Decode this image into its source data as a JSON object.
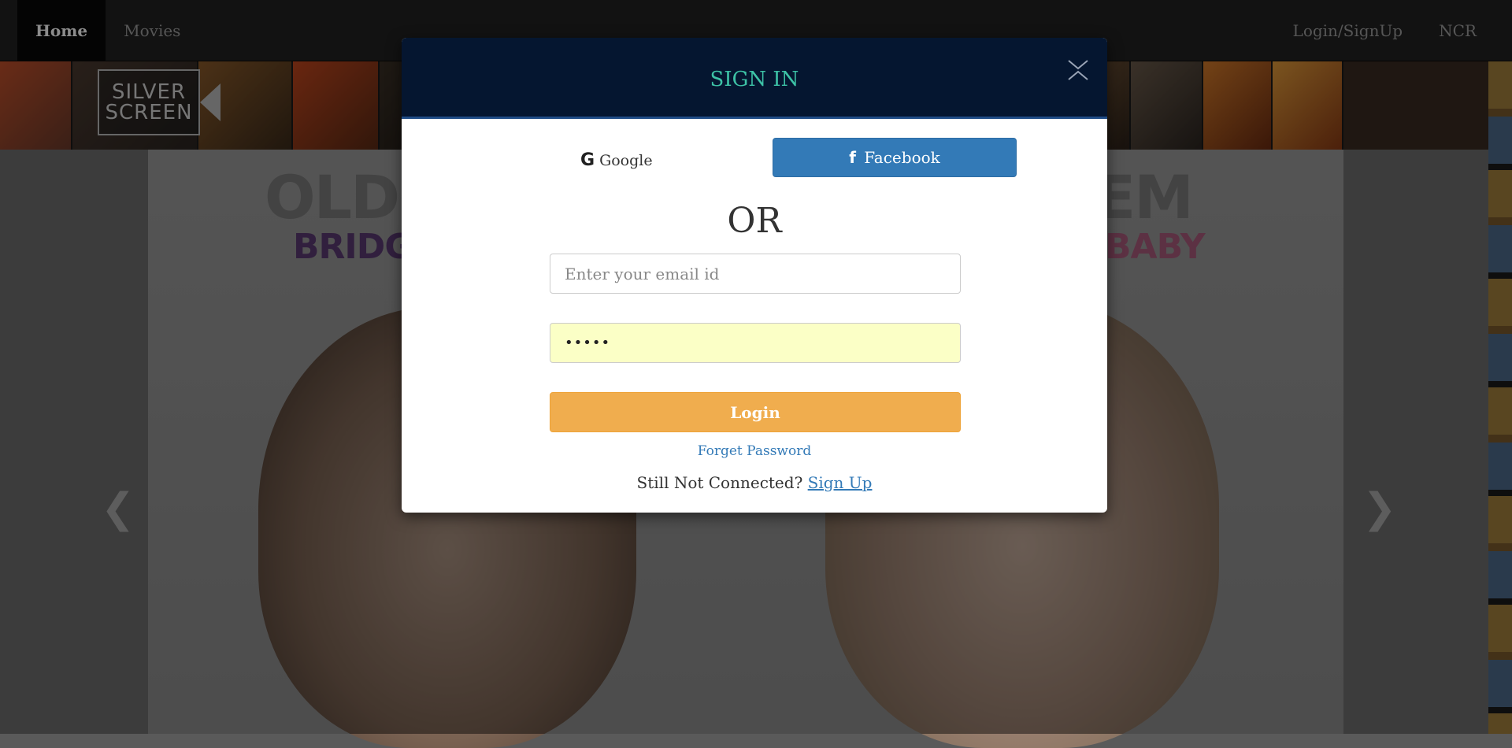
{
  "navbar": {
    "home_label": "Home",
    "movies_label": "Movies",
    "login_label": "Login/SignUp",
    "city_label": "NCR"
  },
  "brand": {
    "logo_line1": "SILVER",
    "logo_line2": "SCREEN"
  },
  "hero": {
    "title_left": "OLD",
    "title_right": "BLEM",
    "subtitle_left": "BRIDGET",
    "subtitle_right": "S BABY",
    "prev_icon": "chevron-left-icon",
    "next_icon": "chevron-right-icon"
  },
  "modal": {
    "title": "SIGN IN",
    "close_icon": "close-icon",
    "google_label": "Google",
    "google_icon": "G",
    "facebook_label": "Facebook",
    "facebook_icon": "f",
    "or_text": "OR",
    "email_placeholder": "Enter your email id",
    "email_value": "",
    "password_value": "•••••",
    "login_label": "Login",
    "forget_label": "Forget Password",
    "signup_prompt": "Still Not Connected?",
    "signup_link": "Sign Up"
  },
  "colors": {
    "header_bg": "#051630",
    "title_color": "#3dc2a6",
    "facebook_blue": "#337ab7",
    "login_orange": "#f0ad4e",
    "password_bg": "#fbffc6"
  }
}
